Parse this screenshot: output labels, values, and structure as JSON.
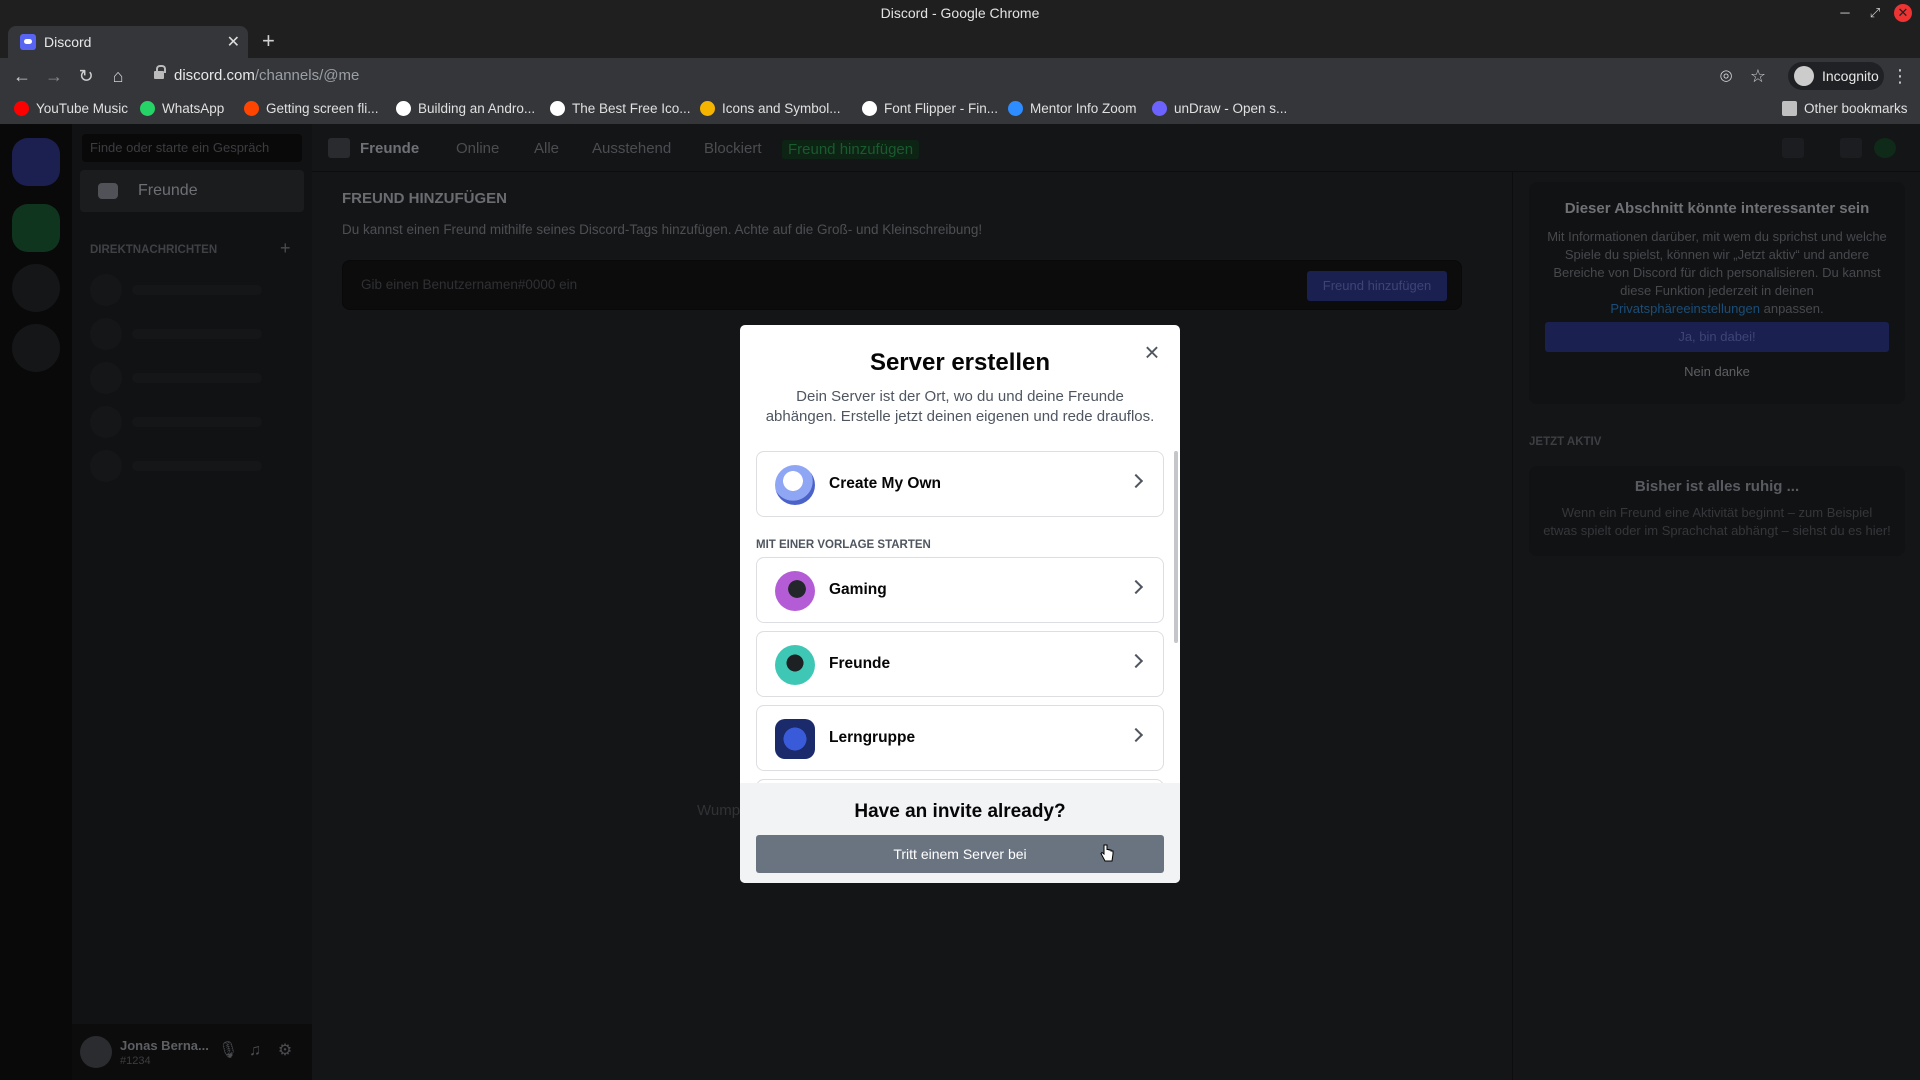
{
  "browser": {
    "window_title": "Discord - Google Chrome",
    "tab_title": "Discord",
    "url_host": "discord.com",
    "url_path": "/channels/@me",
    "profile_label": "Incognito",
    "bookmarks": [
      {
        "label": "YouTube Music",
        "icon": "youtube-music-icon",
        "color": "#ff0000"
      },
      {
        "label": "WhatsApp",
        "icon": "whatsapp-icon",
        "color": "#25d366"
      },
      {
        "label": "Getting screen fli...",
        "icon": "reddit-icon",
        "color": "#ff4500"
      },
      {
        "label": "Building an Andro...",
        "icon": "medium-icon",
        "color": "#ffffff"
      },
      {
        "label": "The Best Free Ico...",
        "icon": "medium-icon",
        "color": "#ffffff"
      },
      {
        "label": "Icons and Symbol...",
        "icon": "icons-site-icon",
        "color": "#f4b400"
      },
      {
        "label": "Font Flipper - Fin...",
        "icon": "fontflipper-icon",
        "color": "#ffffff"
      },
      {
        "label": "Mentor Info Zoom",
        "icon": "zoom-icon",
        "color": "#2d8cff"
      },
      {
        "label": "unDraw - Open s...",
        "icon": "undraw-icon",
        "color": "#6c63ff"
      }
    ],
    "other_bookmarks": "Other bookmarks"
  },
  "discord": {
    "search_placeholder": "Finde oder starte ein Gespräch",
    "friends_label": "Freunde",
    "dm_header": "DIREKTNACHRICHTEN",
    "user_name": "Jonas Berna...",
    "user_tag": "#1234",
    "tabs": [
      "Online",
      "Alle",
      "Ausstehend",
      "Blockiert"
    ],
    "tab_add_friend": "Freund hinzufügen",
    "add_friend_title": "FREUND HINZUFÜGEN",
    "add_friend_desc": "Du kannst einen Freund mithilfe seines Discord-Tags hinzufügen. Achte auf die Groß- und Kleinschreibung!",
    "add_friend_placeholder": "Gib einen Benutzernamen#0000 ein",
    "add_friend_button": "Freund hinzufügen",
    "wumpus_text": "Wumpus wartet auf Freunde.",
    "now_card_title": "Dieser Abschnitt könnte interessanter sein",
    "now_card_text": "Mit Informationen darüber, mit wem du sprichst und welche Spiele du spielst, können wir „Jetzt aktiv“ und andere Bereiche von Discord für dich personalisieren. Du kannst diese Funktion jederzeit in deinen ",
    "now_card_link": "Privatsphäreeinstellungen",
    "now_card_tail": " anpassen.",
    "now_yes": "Ja, bin dabei!",
    "now_no": "Nein danke",
    "active_header": "JETZT AKTIV",
    "quiet_title": "Bisher ist alles ruhig ...",
    "quiet_text": "Wenn ein Freund eine Aktivität beginnt – zum Beispiel etwas spielt oder im Sprachchat abhängt – siehst du es hier!"
  },
  "modal": {
    "title": "Server erstellen",
    "subtitle": "Dein Server ist der Ort, wo du und deine Freunde abhängen. Erstelle jetzt deinen eigenen und rede drauflos.",
    "create_own": "Create My Own",
    "template_header": "MIT EINER VORLAGE STARTEN",
    "templates": [
      "Gaming",
      "Freunde",
      "Lerngruppe"
    ],
    "invite_question": "Have an invite already?",
    "join_button": "Tritt einem Server bei"
  },
  "colors": {
    "discord_blurple": "#5865f2",
    "join_button": "#6a7480",
    "modal_bg": "#ffffff"
  }
}
